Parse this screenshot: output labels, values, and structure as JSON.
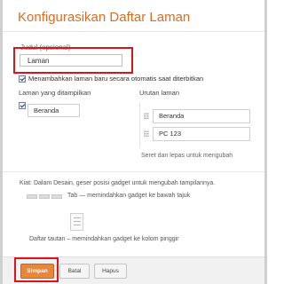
{
  "dialog": {
    "title": "Konfigurasikan Daftar Laman"
  },
  "title_field": {
    "label": "Judul (opsional)",
    "value": "Laman"
  },
  "auto_add": {
    "label": "Menambahkan laman baru secara otomatis saat diterbitkan",
    "checked": true
  },
  "pages_shown": {
    "label": "Laman yang ditampilkan",
    "items": [
      {
        "label": "Beranda",
        "checked": true
      }
    ]
  },
  "page_order": {
    "label": "Urutan laman",
    "items": [
      "Beranda",
      "PC 123"
    ],
    "hint": "Seret dan lepas untuk mengubah"
  },
  "tips": {
    "text": "Kiat: Dalam Desain, geser posisi gadget untuk mengubah tampilannya.",
    "tab_desc": "Tab — memindahkan gadget ke bawah tajuk",
    "list_desc": "Daftar tautan – memindahkan gadget ke kolom pinggir"
  },
  "buttons": {
    "save": "Simpan",
    "cancel": "Batal",
    "delete": "Hapus"
  },
  "colors": {
    "title": "#dd6c21",
    "save_button": "#e8863b",
    "highlight_box": "#d9141f"
  }
}
